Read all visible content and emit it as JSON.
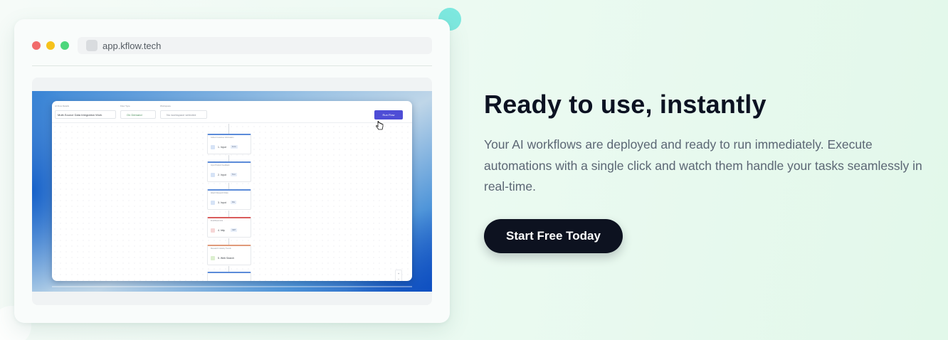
{
  "browser": {
    "url": "app.kflow.tech"
  },
  "app": {
    "flow_name_label": "AI Flow Details",
    "flow_name_value": "Multi-Source Data Integration Work",
    "flow_type_label": "Flow Type",
    "flow_type_value": "On Demand",
    "workspace_label": "Workspace",
    "workspace_value": "No workspace selected",
    "run_button": "Run Flow",
    "nodes": [
      {
        "title": "Collect Customer Information",
        "label": "1. Input",
        "badge": "Form"
      },
      {
        "title": "Input Product Feedback",
        "label": "2. Input",
        "badge": "Text"
      },
      {
        "title": "Attach Research Data",
        "label": "3. Input",
        "badge": "File"
      },
      {
        "title": "Find Brand Info",
        "label": "4. http",
        "badge": "GET"
      },
      {
        "title": "Research Industry Trends",
        "label": "5. Web Search",
        "badge": ""
      }
    ],
    "zoom_controls": [
      "+",
      "−",
      "✕",
      "↺",
      "⛶"
    ]
  },
  "hero": {
    "headline": "Ready to use, instantly",
    "body": "Your AI workflows are deployed and ready to run immediately. Execute automations with a single click and watch them handle your tasks seamlessly in real-time.",
    "cta": "Start Free Today"
  },
  "colors": {
    "accent_button": "#4e4dd6",
    "cta_background": "#0d1220",
    "headline": "#0c1222",
    "teal_blob": "#7de8df"
  }
}
